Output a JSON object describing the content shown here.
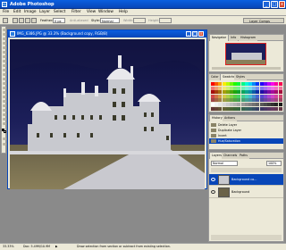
{
  "app": {
    "title": "Adobe Photoshop"
  },
  "menu": [
    "File",
    "Edit",
    "Image",
    "Layer",
    "Select",
    "Filter",
    "View",
    "Window",
    "Help"
  ],
  "options": {
    "feather_label": "Feather:",
    "feather_value": "0 px",
    "anti_alias": "Anti-aliased",
    "style_label": "Style:",
    "style_value": "Normal",
    "width_label": "Width:",
    "height_label": "Height:"
  },
  "palette_well": {
    "label": "Layer Comps"
  },
  "document": {
    "title": "IMG_6386.JPG @ 33.3% (Background copy, RGB/8)"
  },
  "navigator": {
    "tabs": [
      "Navigator",
      "Info",
      "Histogram"
    ]
  },
  "swatches": {
    "tabs": [
      "Color",
      "Swatches",
      "Styles"
    ]
  },
  "history": {
    "tabs": [
      "History",
      "Actions"
    ],
    "items": [
      "Delete Layer",
      "Duplicate Layer",
      "Invert",
      "Hue/Saturation"
    ]
  },
  "layers": {
    "tabs": [
      "Layers",
      "Channels",
      "Paths"
    ],
    "blend": "Normal",
    "opacity": "100%",
    "items": [
      "Background co...",
      "Background"
    ]
  },
  "status": {
    "zoom": "33.33%",
    "doc": "Doc: 5.49M/10.9M",
    "hint": "Draw selection from section or subtract from existing selection."
  }
}
